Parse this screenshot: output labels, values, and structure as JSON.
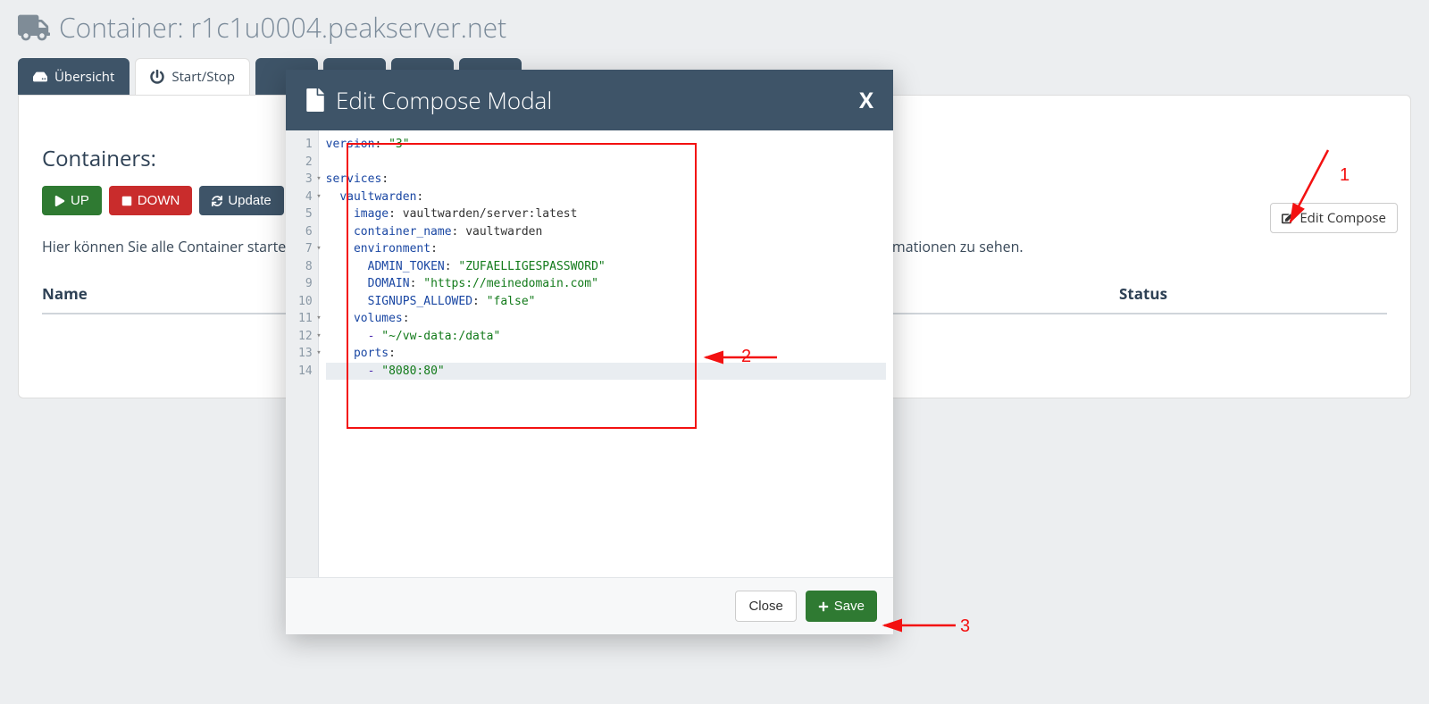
{
  "page": {
    "title_prefix": "Container:",
    "hostname": "r1c1u0004.peakserver.net"
  },
  "tabs": {
    "overview": "Übersicht",
    "startstop": "Start/Stop"
  },
  "containers": {
    "heading": "Containers:",
    "up": "UP",
    "down": "DOWN",
    "update": "Update",
    "help": "Hier können Sie alle Container starten und stoppen. Sie können mit der Maus über die einzelnen Buttons fahren, um mehr Informationen zu sehen.",
    "col_name": "Name",
    "col_status": "Status",
    "edit_compose": "Edit Compose"
  },
  "modal": {
    "title": "Edit Compose Modal",
    "close_btn": "Close",
    "save_btn": "Save",
    "close_x": "X"
  },
  "compose": {
    "line_count": 14,
    "fold_lines": [
      3,
      4,
      7,
      11,
      12,
      13
    ],
    "lines": [
      {
        "indent": 0,
        "type": "kv",
        "key": "version",
        "value": "\"3\""
      },
      {
        "indent": 0,
        "type": "blank"
      },
      {
        "indent": 0,
        "type": "key",
        "key": "services"
      },
      {
        "indent": 1,
        "type": "key",
        "key": "vaultwarden"
      },
      {
        "indent": 2,
        "type": "kv",
        "key": "image",
        "value": "vaultwarden/server:latest",
        "plain": true
      },
      {
        "indent": 2,
        "type": "kv",
        "key": "container_name",
        "value": "vaultwarden",
        "plain": true
      },
      {
        "indent": 2,
        "type": "key",
        "key": "environment"
      },
      {
        "indent": 3,
        "type": "kv",
        "key": "ADMIN_TOKEN",
        "value": "\"ZUFAELLIGESPASSWORD\""
      },
      {
        "indent": 3,
        "type": "kv",
        "key": "DOMAIN",
        "value": "\"https://meinedomain.com\""
      },
      {
        "indent": 3,
        "type": "kv",
        "key": "SIGNUPS_ALLOWED",
        "value": "\"false\""
      },
      {
        "indent": 2,
        "type": "key",
        "key": "volumes"
      },
      {
        "indent": 3,
        "type": "item",
        "value": "\"~/vw-data:/data\""
      },
      {
        "indent": 2,
        "type": "key",
        "key": "ports"
      },
      {
        "indent": 3,
        "type": "item",
        "value": "\"8080:80\"",
        "active": true
      }
    ]
  },
  "annotations": {
    "a1": "1",
    "a2": "2",
    "a3": "3"
  }
}
